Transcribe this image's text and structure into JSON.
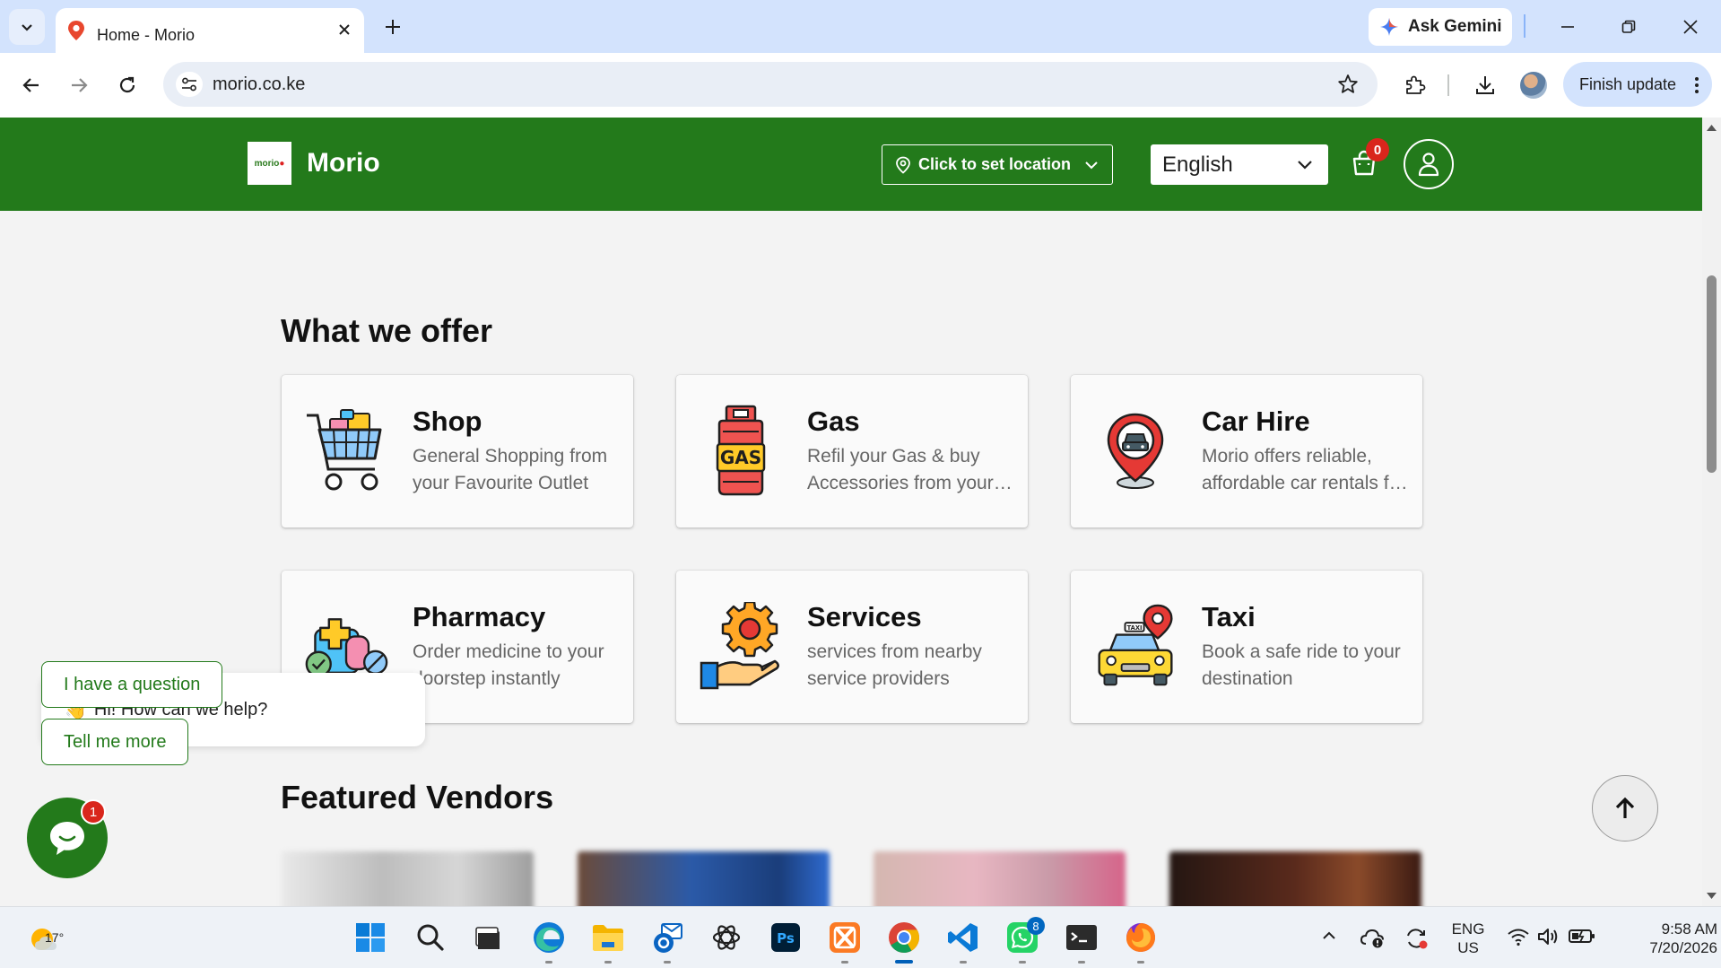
{
  "browser": {
    "tab_title": "Home - Morio",
    "url": "morio.co.ke",
    "ask_gemini": "Ask Gemini",
    "finish_update": "Finish update"
  },
  "header": {
    "logo_text": "morio",
    "brand": "Morio",
    "location_button": "Click to set location",
    "language": "English",
    "cart_count": "0"
  },
  "offers": {
    "title": "What we offer",
    "items": [
      {
        "title": "Shop",
        "line1": "General Shopping from",
        "line2": "your Favourite Outlet",
        "icon": "shopping-cart-icon"
      },
      {
        "title": "Gas",
        "line1": "Refil your Gas & buy",
        "line2": "Accessories from your favourite vendor",
        "icon": "gas-cylinder-icon"
      },
      {
        "title": "Car Hire",
        "line1": "Morio offers reliable,",
        "line2": "affordable car rentals for every journey",
        "icon": "car-location-pin-icon"
      },
      {
        "title": "Pharmacy",
        "line1": "Order medicine to your",
        "line2": "doorstep instantly",
        "icon": "medicine-icon"
      },
      {
        "title": "Services",
        "line1": "services from nearby",
        "line2": "service providers",
        "icon": "gear-hand-icon"
      },
      {
        "title": "Taxi",
        "line1": "Book a safe ride to your",
        "line2": "destination",
        "icon": "taxi-icon"
      }
    ],
    "gas_icon_label": "GAS",
    "taxi_icon_label": "TAXI"
  },
  "vendors": {
    "title": "Featured Vendors",
    "colors": [
      "#cfcfcf",
      "#2b5aa8",
      "#e8b7c2",
      "#5a2a1c"
    ]
  },
  "chat": {
    "greeting": "Hi! How can we help?",
    "emoji": "👋",
    "option1": "I have a question",
    "option2": "Tell me more",
    "unread": "1"
  },
  "taskbar": {
    "temperature": "17°",
    "whatsapp_badge": "8",
    "lang_line1": "ENG",
    "lang_line2": "US",
    "time": "9:58 AM",
    "date": "7/20/2026",
    "ps_label": "Ps"
  },
  "colors": {
    "brand_green": "#237a1b",
    "badge_red": "#d9261c"
  }
}
